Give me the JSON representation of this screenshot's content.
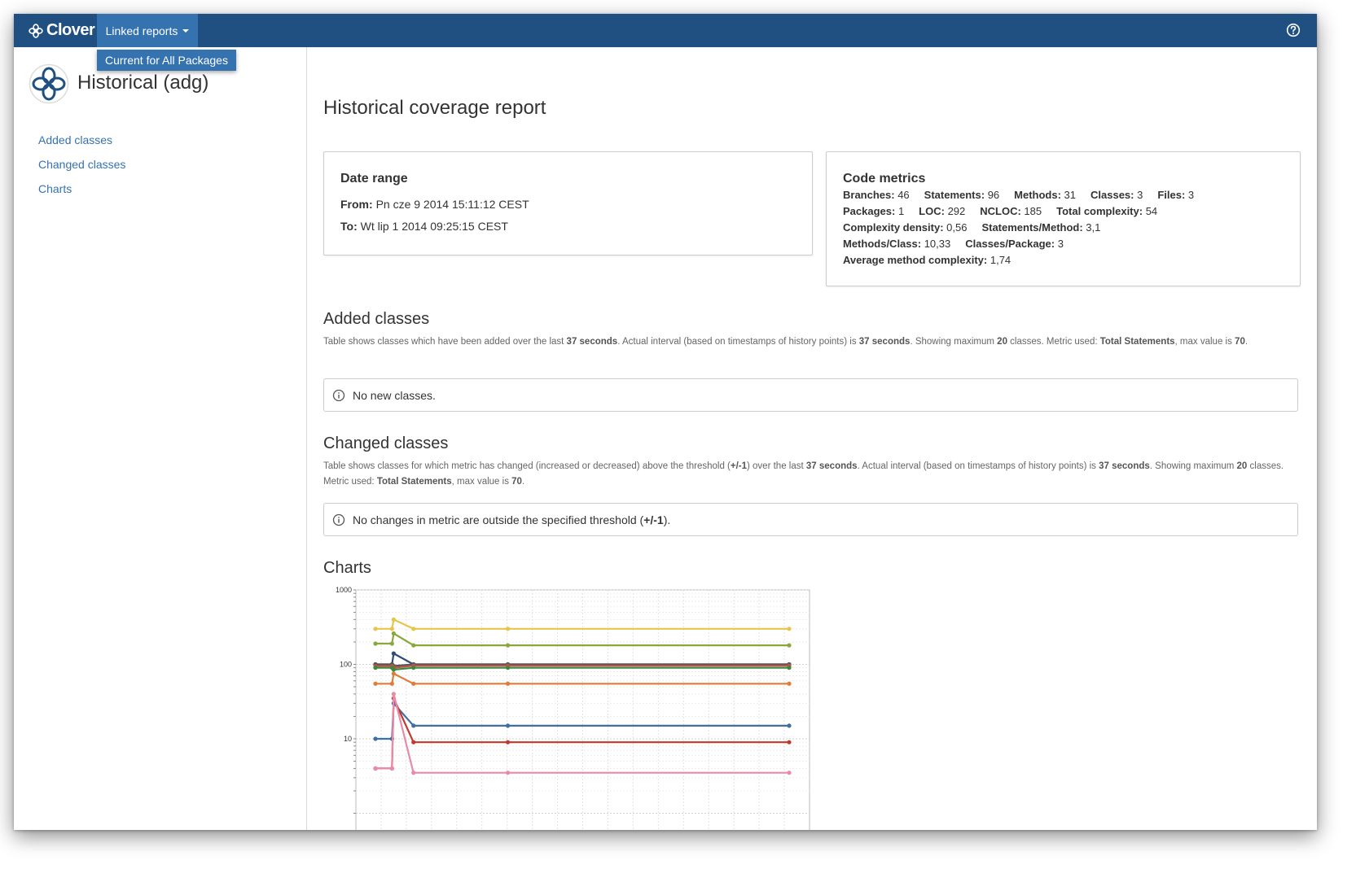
{
  "navbar": {
    "brand": "Clover",
    "linked_reports": "Linked reports",
    "dropdown_item": "Current for All Packages"
  },
  "sidebar": {
    "title": "Historical (adg)",
    "links": [
      "Added classes",
      "Changed classes",
      "Charts"
    ]
  },
  "main": {
    "title": "Historical coverage report",
    "date_range": {
      "title": "Date range",
      "from_label": "From:",
      "from_value": "Pn cze 9 2014 15:11:12 CEST",
      "to_label": "To:",
      "to_value": "Wt lip 1 2014 09:25:15 CEST"
    },
    "metrics": {
      "title": "Code metrics",
      "rows": [
        [
          {
            "l": "Branches:",
            "v": "46"
          },
          {
            "l": "Statements:",
            "v": "96"
          },
          {
            "l": "Methods:",
            "v": "31"
          },
          {
            "l": "Classes:",
            "v": "3"
          },
          {
            "l": "Files:",
            "v": "3"
          }
        ],
        [
          {
            "l": "Packages:",
            "v": "1"
          },
          {
            "l": "LOC:",
            "v": "292"
          },
          {
            "l": "NCLOC:",
            "v": "185"
          },
          {
            "l": "Total complexity:",
            "v": "54"
          }
        ],
        [
          {
            "l": "Complexity density:",
            "v": "0,56"
          },
          {
            "l": "Statements/Method:",
            "v": "3,1"
          }
        ],
        [
          {
            "l": "Methods/Class:",
            "v": "10,33"
          },
          {
            "l": "Classes/Package:",
            "v": "3"
          }
        ],
        [
          {
            "l": "Average method complexity:",
            "v": "1,74"
          }
        ]
      ]
    },
    "added": {
      "title": "Added classes",
      "desc": [
        {
          "t": "Table shows classes which have been added over the last "
        },
        {
          "t": "37 seconds",
          "b": true
        },
        {
          "t": ". Actual interval (based on timestamps of history points) is "
        },
        {
          "t": "37 seconds",
          "b": true
        },
        {
          "t": ". Showing maximum "
        },
        {
          "t": "20",
          "b": true
        },
        {
          "t": " classes. Metric used: "
        },
        {
          "t": "Total Statements",
          "b": true
        },
        {
          "t": ", max value is "
        },
        {
          "t": "70",
          "b": true
        },
        {
          "t": "."
        }
      ],
      "info": [
        {
          "t": "No new classes."
        }
      ]
    },
    "changed": {
      "title": "Changed classes",
      "desc": [
        {
          "t": "Table shows classes for which metric has changed (increased or decreased) above the threshold ("
        },
        {
          "t": "+/-1",
          "b": true
        },
        {
          "t": ") over the last "
        },
        {
          "t": "37 seconds",
          "b": true
        },
        {
          "t": ". Actual interval (based on timestamps of history points) is "
        },
        {
          "t": "37 seconds",
          "b": true
        },
        {
          "t": ". Showing maximum "
        },
        {
          "t": "20",
          "b": true
        },
        {
          "t": " classes. Metric used: "
        },
        {
          "t": "Total Statements",
          "b": true
        },
        {
          "t": ", max value is "
        },
        {
          "t": "70",
          "b": true
        },
        {
          "t": "."
        }
      ],
      "info": [
        {
          "t": "No changes in metric are outside the specified threshold ("
        },
        {
          "t": "+/-1",
          "b": true
        },
        {
          "t": ")."
        }
      ]
    },
    "charts_title": "Charts"
  },
  "colors": {
    "navbar": "#205081",
    "accent": "#3572b0",
    "link": "#3572b0"
  },
  "chart_data": {
    "type": "line",
    "y_scale": "log",
    "ylim": [
      1,
      1000
    ],
    "y_ticks": [
      "1000",
      "100",
      "10"
    ],
    "x_ticks": [],
    "grid": true,
    "x": [
      0,
      1,
      1.1,
      2.3,
      8,
      25
    ],
    "series": [
      {
        "color": "#e6c64a",
        "values": [
          300,
          300,
          400,
          300,
          300,
          300
        ]
      },
      {
        "color": "#8aa83a",
        "values": [
          190,
          190,
          260,
          180,
          180,
          180
        ]
      },
      {
        "color": "#2d4d78",
        "values": [
          100,
          100,
          140,
          100,
          100,
          100
        ]
      },
      {
        "color": "#555555",
        "values": [
          100,
          100,
          95,
          100,
          100,
          100
        ]
      },
      {
        "color": "#c0504d",
        "values": [
          95,
          95,
          90,
          96,
          96,
          96
        ]
      },
      {
        "color": "#3a8a3a",
        "values": [
          90,
          90,
          85,
          90,
          90,
          90
        ]
      },
      {
        "color": "#e07b39",
        "values": [
          55,
          55,
          75,
          55,
          55,
          55
        ]
      },
      {
        "color": "#3f6fa3",
        "values": [
          10,
          10,
          30,
          15,
          15,
          15
        ]
      },
      {
        "color": "#c0392b",
        "values": [
          4,
          4,
          35,
          9,
          9,
          9
        ]
      },
      {
        "color": "#e88aa8",
        "values": [
          4,
          4,
          40,
          3.5,
          3.5,
          3.5
        ]
      }
    ]
  }
}
